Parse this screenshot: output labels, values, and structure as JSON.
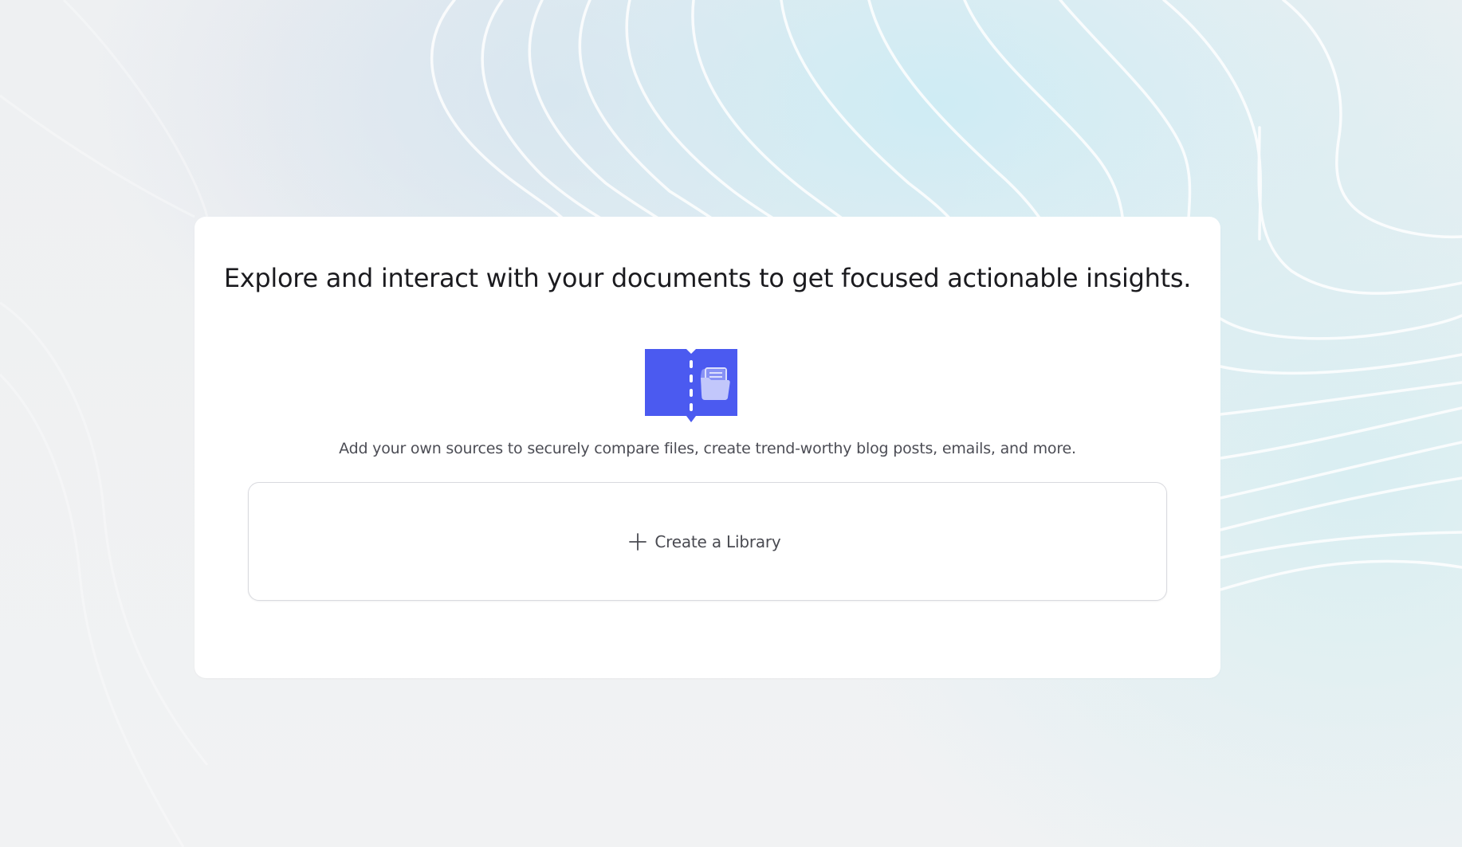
{
  "main": {
    "headline": "Explore and interact with your documents to get focused actionable insights.",
    "subtext": "Add your own sources to securely compare files, create trend-worthy blog posts, emails, and more.",
    "create_label": "Create a Library",
    "icon": "book-folder-icon",
    "create_icon": "plus-icon"
  },
  "colors": {
    "accent": "#4b5af0",
    "icon_folder": "#b9bff9"
  }
}
